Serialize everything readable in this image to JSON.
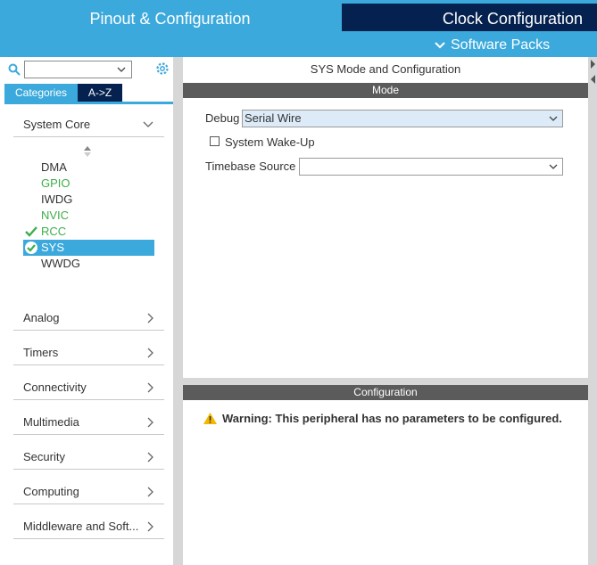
{
  "header": {
    "pinout_tab": "Pinout & Configuration",
    "clock_tab": "Clock Configuration",
    "software_packs": "Software Packs"
  },
  "sidebar": {
    "tabs": {
      "categories": "Categories",
      "az": "A->Z"
    },
    "system_core": {
      "label": "System Core",
      "items": [
        {
          "label": "DMA",
          "state": "normal"
        },
        {
          "label": "GPIO",
          "state": "green"
        },
        {
          "label": "IWDG",
          "state": "normal"
        },
        {
          "label": "NVIC",
          "state": "green"
        },
        {
          "label": "RCC",
          "state": "checked"
        },
        {
          "label": "SYS",
          "state": "selected"
        },
        {
          "label": "WWDG",
          "state": "normal"
        }
      ]
    },
    "categories": [
      "Analog",
      "Timers",
      "Connectivity",
      "Multimedia",
      "Security",
      "Computing",
      "Middleware and Soft..."
    ]
  },
  "main": {
    "title": "SYS Mode and Configuration",
    "mode_header": "Mode",
    "debug_label": "Debug",
    "debug_value": "Serial Wire",
    "wakeup_label": "System Wake-Up",
    "timebase_label": "Timebase Source",
    "timebase_value": "",
    "config_header": "Configuration",
    "warning_text": "Warning: This peripheral has no parameters to be configured."
  },
  "colors": {
    "accent": "#3ca9dc",
    "dark_tab": "#04214f",
    "section_bar": "#5b5b5b",
    "green": "#3dae49",
    "warning": "#f5b800"
  }
}
